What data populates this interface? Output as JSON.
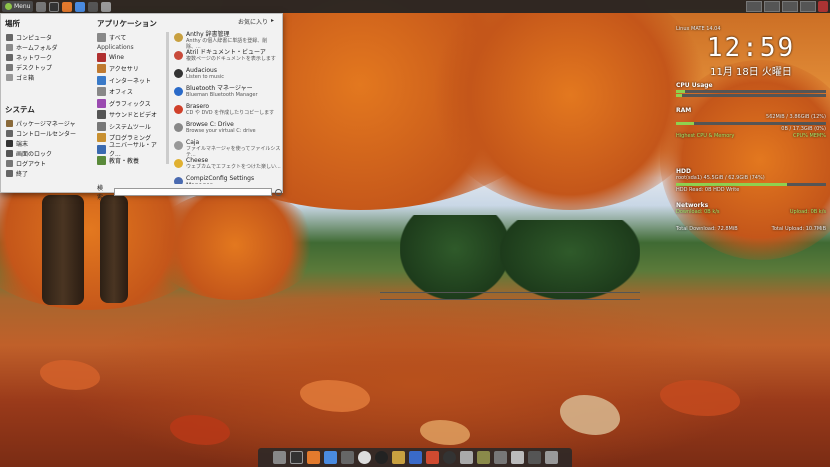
{
  "top_panel": {
    "menu_label": "Menu"
  },
  "menu": {
    "places_title": "場所",
    "places": [
      "コンピュータ",
      "ホームフォルダ",
      "ネットワーク",
      "デスクトップ",
      "ゴミ箱"
    ],
    "system_title": "システム",
    "system": [
      "パッケージマネージャ",
      "コントロールセンター",
      "端末",
      "画面のロック",
      "ログアウト",
      "終了"
    ],
    "apps_title": "アプリケーション",
    "all_label": "すべて",
    "apps_sub": "Applications",
    "categories": [
      "Wine",
      "アクセサリ",
      "インターネット",
      "オフィス",
      "グラフィックス",
      "サウンドとビデオ",
      "システムツール",
      "プログラミング",
      "ユニバーサル・アク...",
      "教育・教養"
    ],
    "favorites_label": "お気に入り",
    "items": [
      {
        "title": "Anthy 辞書管理",
        "desc": "Anthy の個人辞書に単語を登録、削除、..."
      },
      {
        "title": "Atril ドキュメント・ビューア",
        "desc": "複数ページのドキュメントを表示します"
      },
      {
        "title": "Audacious",
        "desc": "Listen to music"
      },
      {
        "title": "Bluetooth マネージャー",
        "desc": "Blueman Bluetooth Manager"
      },
      {
        "title": "Brasero",
        "desc": "CD や DVD を作成したりコピーします"
      },
      {
        "title": "Browse C: Drive",
        "desc": "Browse your virtual C: drive"
      },
      {
        "title": "Caja",
        "desc": "ファイルマネージャを使ってファイルシステ..."
      },
      {
        "title": "Cheese",
        "desc": "ウェブカムでエフェクトをつけた楽しい..."
      },
      {
        "title": "CompizConfig Settings Manager",
        "desc": ""
      }
    ],
    "search_label": "検索:",
    "search_value": ""
  },
  "conky": {
    "top_label": "Linux MATE 14.04",
    "time": "12:59",
    "date": "11月 18日 火曜日",
    "cpu_title": "CPU Usage",
    "ram_label": "RAM",
    "ram_value": "562MiB / 3.86GiB (12%)",
    "ram_fraction": 0.12,
    "swap_value": "0B / 17.3GiB (0%)",
    "procs_title": "Highest CPU & Memory",
    "procs_cols": "CPU% MEM%",
    "hdd_title": "HDD",
    "hdd_root": "root(sda1) 45.5GiB / 62.9GiB (74%)",
    "hdd_fraction": 0.74,
    "hdd_io": "HDD Read: 0B   HDD Write",
    "net_title": "Networks",
    "download": "Download: 0B  k/s",
    "upload": "Upload: 0B  k/s",
    "total_down": "Total Download: 72.8MiB",
    "total_up": "Total Upload: 10.7MiB"
  },
  "colors": {
    "accent": "#8fc44a",
    "panel": "#232323",
    "menu_bg": "#f2f2f2"
  }
}
